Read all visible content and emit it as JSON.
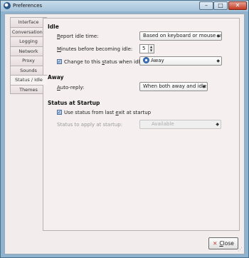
{
  "window": {
    "title": "Preferences",
    "minimize_glyph": "–",
    "maximize_glyph": "□",
    "close_glyph": "✕"
  },
  "tabs": [
    {
      "label": "Interface",
      "active": false
    },
    {
      "label": "Conversations",
      "active": false
    },
    {
      "label": "Logging",
      "active": false
    },
    {
      "label": "Network",
      "active": false
    },
    {
      "label": "Proxy",
      "active": false
    },
    {
      "label": "Sounds",
      "active": false
    },
    {
      "label": "Status / Idle",
      "active": true
    },
    {
      "label": "Themes",
      "active": false
    }
  ],
  "idle": {
    "heading": "Idle",
    "report_label_accel": "R",
    "report_label_rest": "eport idle time:",
    "report_value": "Based on keyboard or mouse use",
    "minutes_label_accel": "M",
    "minutes_label_rest": "inutes before becoming idle:",
    "minutes_value": "5",
    "change_status_checked": true,
    "change_status_label_pre": "Change to this ",
    "change_status_accel": "s",
    "change_status_label_post": "tatus when idle:",
    "status_value": "Away"
  },
  "away": {
    "heading": "Away",
    "autoreply_label_pre": "",
    "autoreply_accel": "A",
    "autoreply_label_rest": "uto-reply:",
    "autoreply_value": "When both away and idle"
  },
  "startup": {
    "heading": "Status at Startup",
    "use_last_checked": true,
    "use_last_label_pre": "Use status from last ",
    "use_last_accel": "e",
    "use_last_label_post": "xit at startup",
    "apply_label": "Status to apply at startup:",
    "apply_value": "Available"
  },
  "footer": {
    "close_label_accel": "C",
    "close_label_rest": "lose"
  },
  "icons": {
    "check_glyph": "✓",
    "dropdown_glyph": "◆",
    "spin_up": "▲",
    "spin_down": "▼",
    "close_x": "✕",
    "grip": "⋰"
  }
}
